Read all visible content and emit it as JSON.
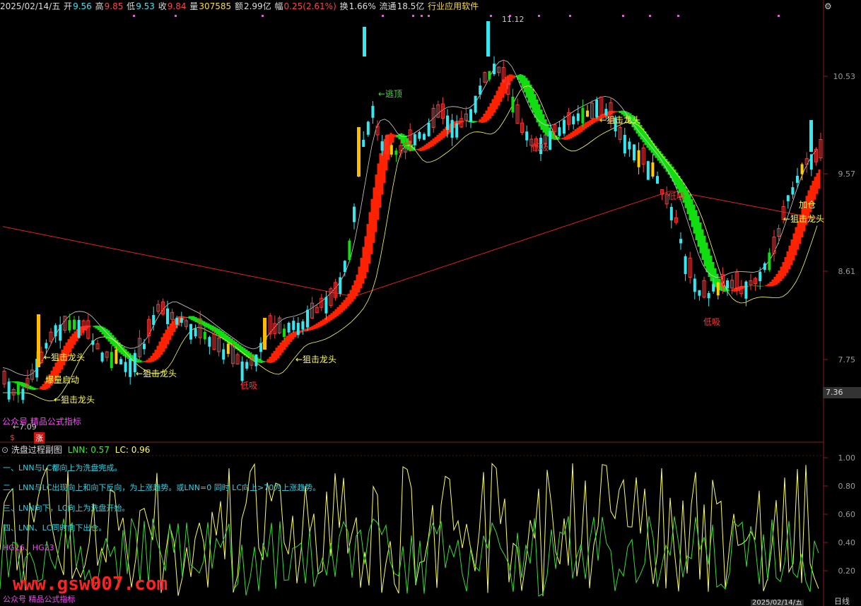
{
  "info_bar": {
    "date": "2025/02/14/五",
    "open_label": "开",
    "open": "9.56",
    "high_label": "高",
    "high": "9.85",
    "low_label": "低",
    "low": "9.53",
    "close_label": "收",
    "close": "9.84",
    "vol_label": "量",
    "vol": "307585",
    "amount_label": "额",
    "amount": "2.99亿",
    "change_label": "幅",
    "change": "0.25(2.61%)",
    "turnover_label": "换",
    "turnover": "1.66%",
    "float_label": "流通",
    "float": "18.5亿",
    "software": "行业应用软件"
  },
  "main_axis": {
    "labels": [
      "10.53",
      "9.57",
      "8.61",
      "7.75"
    ],
    "current": "7.36"
  },
  "annotations": {
    "high_peak": "11.12",
    "low_start": "←7.09",
    "escape_top": "←逃顶",
    "burst_start": "爆量启动",
    "snipe_dragon": "狙击龙头",
    "arrow_snipe": "←狙击龙头",
    "low_suck": "低吸",
    "add_pos": "加仓",
    "public_tag": "公众号 精品公式指标",
    "dollar": "$",
    "rise": "涨"
  },
  "sub_chart": {
    "title": "洗盘过程副图",
    "lnn_label": "LNN: 0.57",
    "lc_label": "LC: 0.96",
    "desc1": "一、LNN与LC都向上为洗盘完成。",
    "desc2": "二、LNN与LC出现向上和向下反向，为上涨趋势。或LNN=0 同时 LC向上>70为上涨趋势。",
    "desc3": "三、LNN向下，LC向上为洗盘开始。",
    "desc4": "四、LNN、LC同时向下出仓。",
    "hg": "HG26、HG23",
    "axis": [
      "1.00",
      "0.80",
      "0.60",
      "0.40",
      "0.20"
    ],
    "watermark": "www.gsw007.com",
    "footer_tag": "公众号 精品公式指标",
    "date_tag": "2025/02/14/五",
    "corner": "日线"
  },
  "colors": {
    "bull": "#ff3b3b",
    "bear": "#35e8f0",
    "band_up": "#ff2200",
    "band_down": "#11dd11",
    "ma": "#e02020",
    "yellow": "#ffff55",
    "magenta": "#ff44ff",
    "bg": "#000000"
  }
}
